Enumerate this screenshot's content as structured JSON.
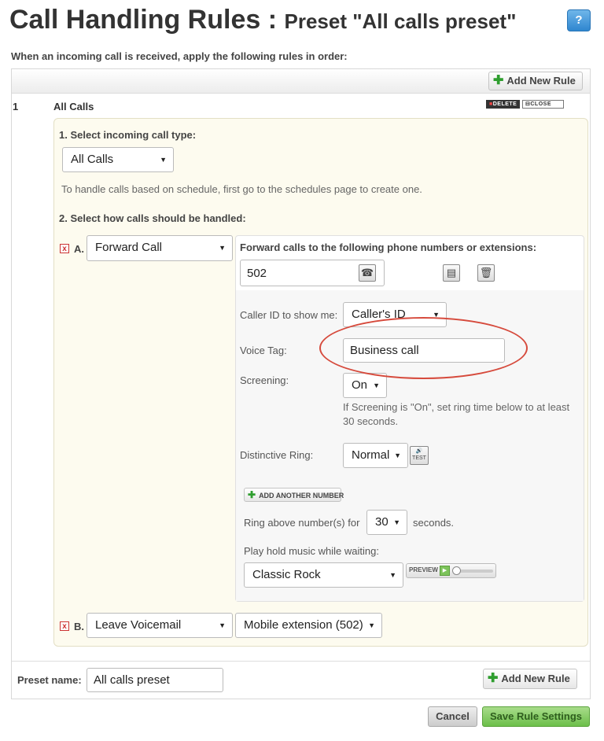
{
  "header": {
    "title_main": "Call Handling Rules : ",
    "title_preset": "Preset \"All calls preset\"",
    "help_label": "?"
  },
  "intro_text": "When an incoming call is received, apply the following rules in order:",
  "add_new_rule_label": "Add New Rule",
  "rule": {
    "number": "1",
    "name": "All Calls",
    "delete_label": "DELETE",
    "close_label": "CLOSE",
    "step1_label": "1. Select incoming call type:",
    "call_type_value": "All Calls",
    "schedule_hint": "To handle calls based on schedule, first go to the schedules page to create one.",
    "step2_label": "2. Select how calls should be handled:",
    "actions": [
      {
        "letter": "A.",
        "action_value": "Forward Call",
        "forward_heading": "Forward calls to the following phone numbers or extensions:",
        "number_value": "502",
        "caller_id_label": "Caller ID to show me:",
        "caller_id_value": "Caller's ID",
        "voice_tag_label": "Voice Tag:",
        "voice_tag_value": "Business call",
        "screening_label": "Screening:",
        "screening_value": "On",
        "screening_hint": "If Screening is \"On\", set ring time below to at least 30 seconds.",
        "distinctive_ring_label": "Distinctive Ring:",
        "distinctive_ring_value": "Normal",
        "test_label": "TEST",
        "add_another_number_label": "ADD ANOTHER NUMBER",
        "ring_above_label": "Ring above number(s) for",
        "ring_seconds_value": "30",
        "seconds_label": "seconds.",
        "hold_music_label": "Play hold music while waiting:",
        "hold_music_value": "Classic Rock",
        "preview_label": "PREVIEW"
      },
      {
        "letter": "B.",
        "action_value": "Leave Voicemail",
        "target_value": "Mobile extension (502)"
      }
    ]
  },
  "footer": {
    "preset_name_label": "Preset name:",
    "preset_name_value": "All calls preset",
    "cancel_label": "Cancel",
    "save_label": "Save Rule Settings"
  },
  "colors": {
    "accent_green": "#6cbf4a",
    "highlight_red": "#d64a3c",
    "panel_bg": "#fdfbef"
  }
}
